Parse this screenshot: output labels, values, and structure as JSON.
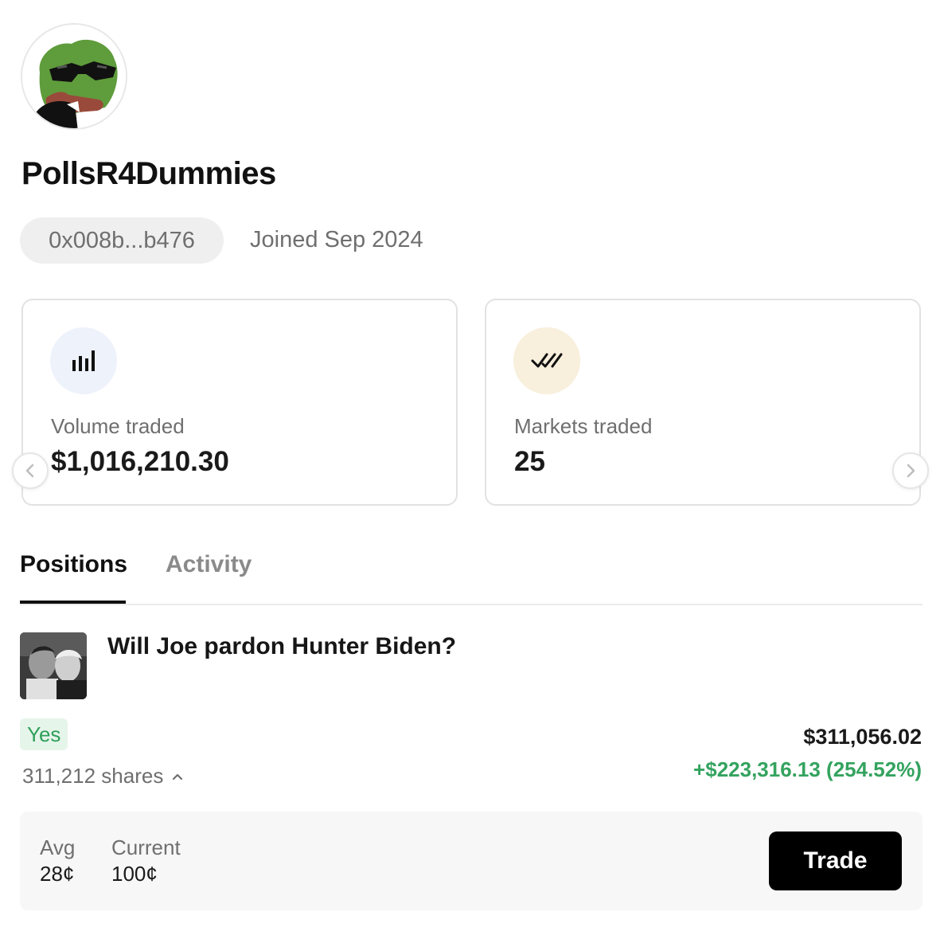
{
  "profile": {
    "username": "PollsR4Dummies",
    "address": "0x008b...b476",
    "joined": "Joined Sep 2024",
    "avatar_icon": "frog-avatar-icon"
  },
  "stats": [
    {
      "label": "Volume traded",
      "value": "$1,016,210.30",
      "icon": "bar-chart-icon",
      "icon_bg": "#eef2fb"
    },
    {
      "label": "Markets traded",
      "value": "25",
      "icon": "double-check-icon",
      "icon_bg": "#f8efdc"
    }
  ],
  "tabs": [
    {
      "label": "Positions",
      "active": true
    },
    {
      "label": "Activity",
      "active": false
    }
  ],
  "position": {
    "market_title": "Will Joe pardon Hunter Biden?",
    "outcome": "Yes",
    "shares": "311,212 shares",
    "value": "$311,056.02",
    "pnl": "+$223,316.13 (254.52%)",
    "avg_label": "Avg",
    "avg_value": "28¢",
    "current_label": "Current",
    "current_value": "100¢",
    "trade_label": "Trade"
  },
  "colors": {
    "positive": "#34a35f",
    "badge_bg": "#e6f5ea",
    "button_bg": "#000000"
  }
}
